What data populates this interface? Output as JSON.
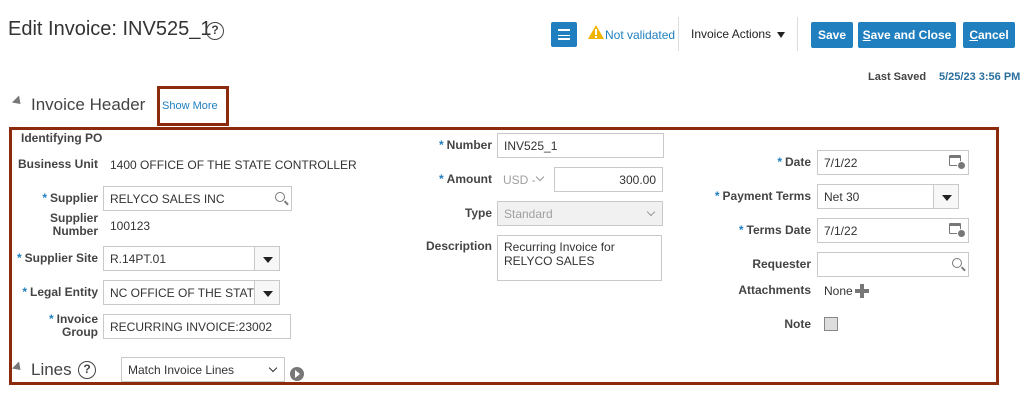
{
  "header": {
    "title": "Edit Invoice: INV525_1",
    "validation_status": "Not validated",
    "invoice_actions": "Invoice Actions",
    "save": "Save",
    "save_and_close_pre": "S",
    "save_and_close_rest": "ave and Close",
    "cancel_pre": "C",
    "cancel_rest": "ancel",
    "last_saved_label": "Last Saved",
    "last_saved_value": "5/25/23 3:56 PM"
  },
  "invoice_header": {
    "title": "Invoice Header",
    "show_more": "Show More",
    "left": {
      "identifying_po_label": "Identifying PO",
      "business_unit_label": "Business Unit",
      "business_unit_value": "1400 OFFICE OF THE STATE CONTROLLER",
      "supplier_label": "Supplier",
      "supplier_value": "RELYCO SALES INC",
      "supplier_number_label_1": "Supplier",
      "supplier_number_label_2": "Number",
      "supplier_number_value": "100123",
      "supplier_site_label": "Supplier Site",
      "supplier_site_value": "R.14PT.01",
      "legal_entity_label": "Legal Entity",
      "legal_entity_value": "NC OFFICE OF THE STATE",
      "invoice_group_label_1": "Invoice",
      "invoice_group_label_2": "Group",
      "invoice_group_value": "RECURRING INVOICE:23002"
    },
    "middle": {
      "number_label": "Number",
      "number_value": "INV525_1",
      "amount_label": "Amount",
      "currency_value": "USD -",
      "amount_value": "300.00",
      "type_label": "Type",
      "type_value": "Standard",
      "description_label": "Description",
      "description_value": "Recurring Invoice for RELYCO SALES"
    },
    "right": {
      "date_label": "Date",
      "date_value": "7/1/22",
      "payment_terms_label": "Payment Terms",
      "payment_terms_value": "Net 30",
      "terms_date_label": "Terms Date",
      "terms_date_value": "7/1/22",
      "requester_label": "Requester",
      "requester_value": "",
      "attachments_label": "Attachments",
      "attachments_value": "None",
      "note_label": "Note"
    }
  },
  "lines": {
    "title": "Lines",
    "match_select_value": "Match Invoice Lines"
  },
  "colors": {
    "accent": "#1f7fbf",
    "highlight_border": "#8b2a0c",
    "warning": "#f0b400"
  },
  "required_marker": "*"
}
